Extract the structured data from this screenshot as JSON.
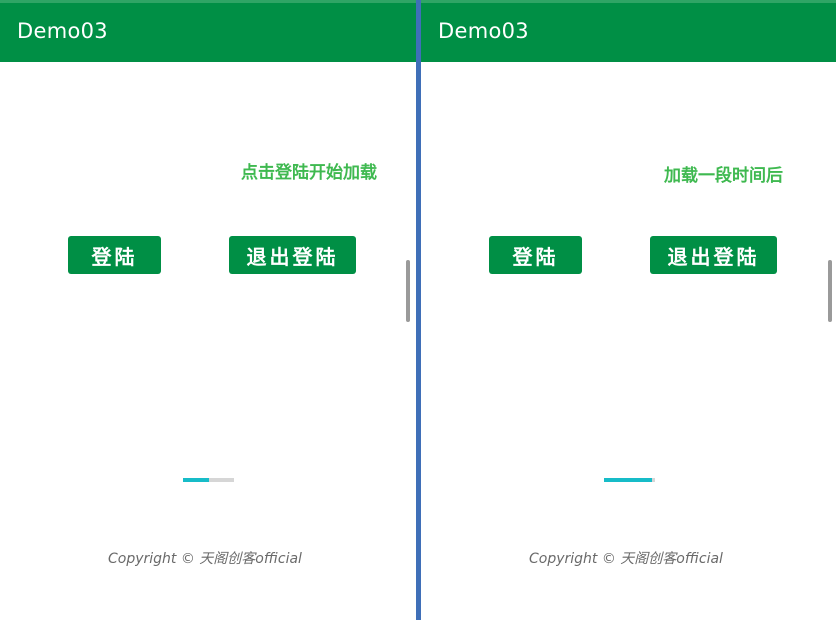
{
  "left": {
    "app_title": "Demo03",
    "annotation": "点击登陆开始加载",
    "login_label": "登陆",
    "logout_label": "退出登陆",
    "progress": 0.5,
    "copyright": "Copyright © 天阁创客official"
  },
  "right": {
    "app_title": "Demo03",
    "annotation": "加载一段时间后",
    "login_label": "登陆",
    "logout_label": "退出登陆",
    "progress": 0.94,
    "copyright": "Copyright © 天阁创客official"
  },
  "colors": {
    "appbar": "#008f45",
    "accent_text": "#3fb950",
    "progress_fill": "#17bcc8",
    "progress_track": "#d6d6d6"
  }
}
